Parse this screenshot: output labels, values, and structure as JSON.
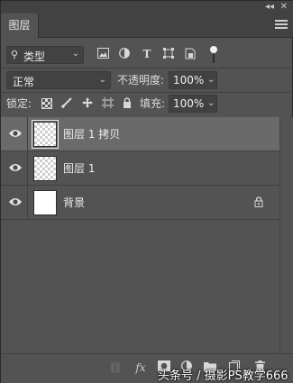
{
  "panel": {
    "tab_label": "图层",
    "collapse_glyph": "◂◂",
    "close_glyph": "✕"
  },
  "filter": {
    "kind_label": "类型",
    "search_glyph": "⚲",
    "chevron": "⌄",
    "icons": [
      "image-filter-icon",
      "adjustment-filter-icon",
      "type-filter-icon",
      "shape-filter-icon",
      "smart-object-filter-icon"
    ],
    "type_glyph": "T"
  },
  "blend": {
    "mode": "正常",
    "opacity_label": "不透明度:",
    "opacity_value": "100%"
  },
  "lock": {
    "label": "锁定:",
    "fill_label": "填充:",
    "fill_value": "100%"
  },
  "layers": [
    {
      "name": "图层 1 拷贝",
      "selected": true,
      "thumb": "transparent",
      "locked": false
    },
    {
      "name": "图层 1",
      "selected": false,
      "thumb": "transparent",
      "locked": false
    },
    {
      "name": "背景",
      "selected": false,
      "thumb": "white",
      "locked": true
    }
  ],
  "bottom": {
    "link_glyph": "⛓",
    "fx_glyph": "fx",
    "watermark": "头条号 / 摄影PS教学666"
  },
  "colors": {
    "panel_bg": "#535353",
    "selected_row": "#6a6a6a",
    "field_bg": "#424242"
  }
}
